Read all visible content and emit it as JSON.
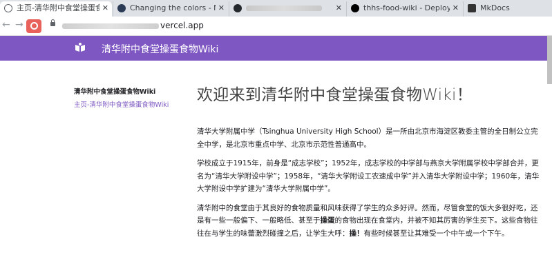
{
  "browser": {
    "tabs": [
      {
        "title": "主页-清华附中食堂操蛋食物Wiki",
        "favicon_color": "#5f6368",
        "active": true
      },
      {
        "title": "Changing the colors - Material",
        "favicon_color": "#2b3a55",
        "active": false
      },
      {
        "title": "",
        "favicon_color": "#24292e",
        "active": false
      },
      {
        "title": "thhs-food-wiki - Deployment",
        "favicon_color": "#000000",
        "active": false
      },
      {
        "title": "MkDocs",
        "favicon_color": "#333333",
        "active": false
      }
    ],
    "url_suffix": "vercel.app"
  },
  "site": {
    "title": "清华附中食堂操蛋食物Wiki",
    "header_color": "#7e57c2"
  },
  "sidebar": {
    "title": "清华附中食堂操蛋食物Wiki",
    "link": "主页-清华附中食堂操蛋食物Wiki"
  },
  "content": {
    "heading": "欢迎来到清华附中食堂操蛋食物Wiki！",
    "p1": "清华大学附属中学（Tsinghua University High School）是一所由北京市海淀区教委主管的全日制公立完全中学，是北京市重点中学、北京市示范性普通高中。",
    "p2": "学校成立于1915年，前身是“成志学校”；1952年，成志学校的中学部与燕京大学附属学校中学部合并，更名为“清华大学附设中学”；1958年，“清华大学附设工农速成中学”并入清华大学附设中学；1960年，清华大学附设中学扩建为“清华大学附属中学”。",
    "p3_a": "清华附中的食堂由于其良好的食物质量和风味获得了学生的众多好评。然而，尽管食堂的饭大多很好吃，还是有一些一般偏下、一般略低、甚至于",
    "p3_bold1": "操蛋",
    "p3_b": "的食物出现在食堂内，并被不知其厉害的学生买下。这些食物往往在与学生的味蕾激烈碰撞之后，让学生大呼：",
    "p3_bold2": "操！",
    "p3_c": "有些时候甚至让其难受一个中午或一个下午。"
  }
}
